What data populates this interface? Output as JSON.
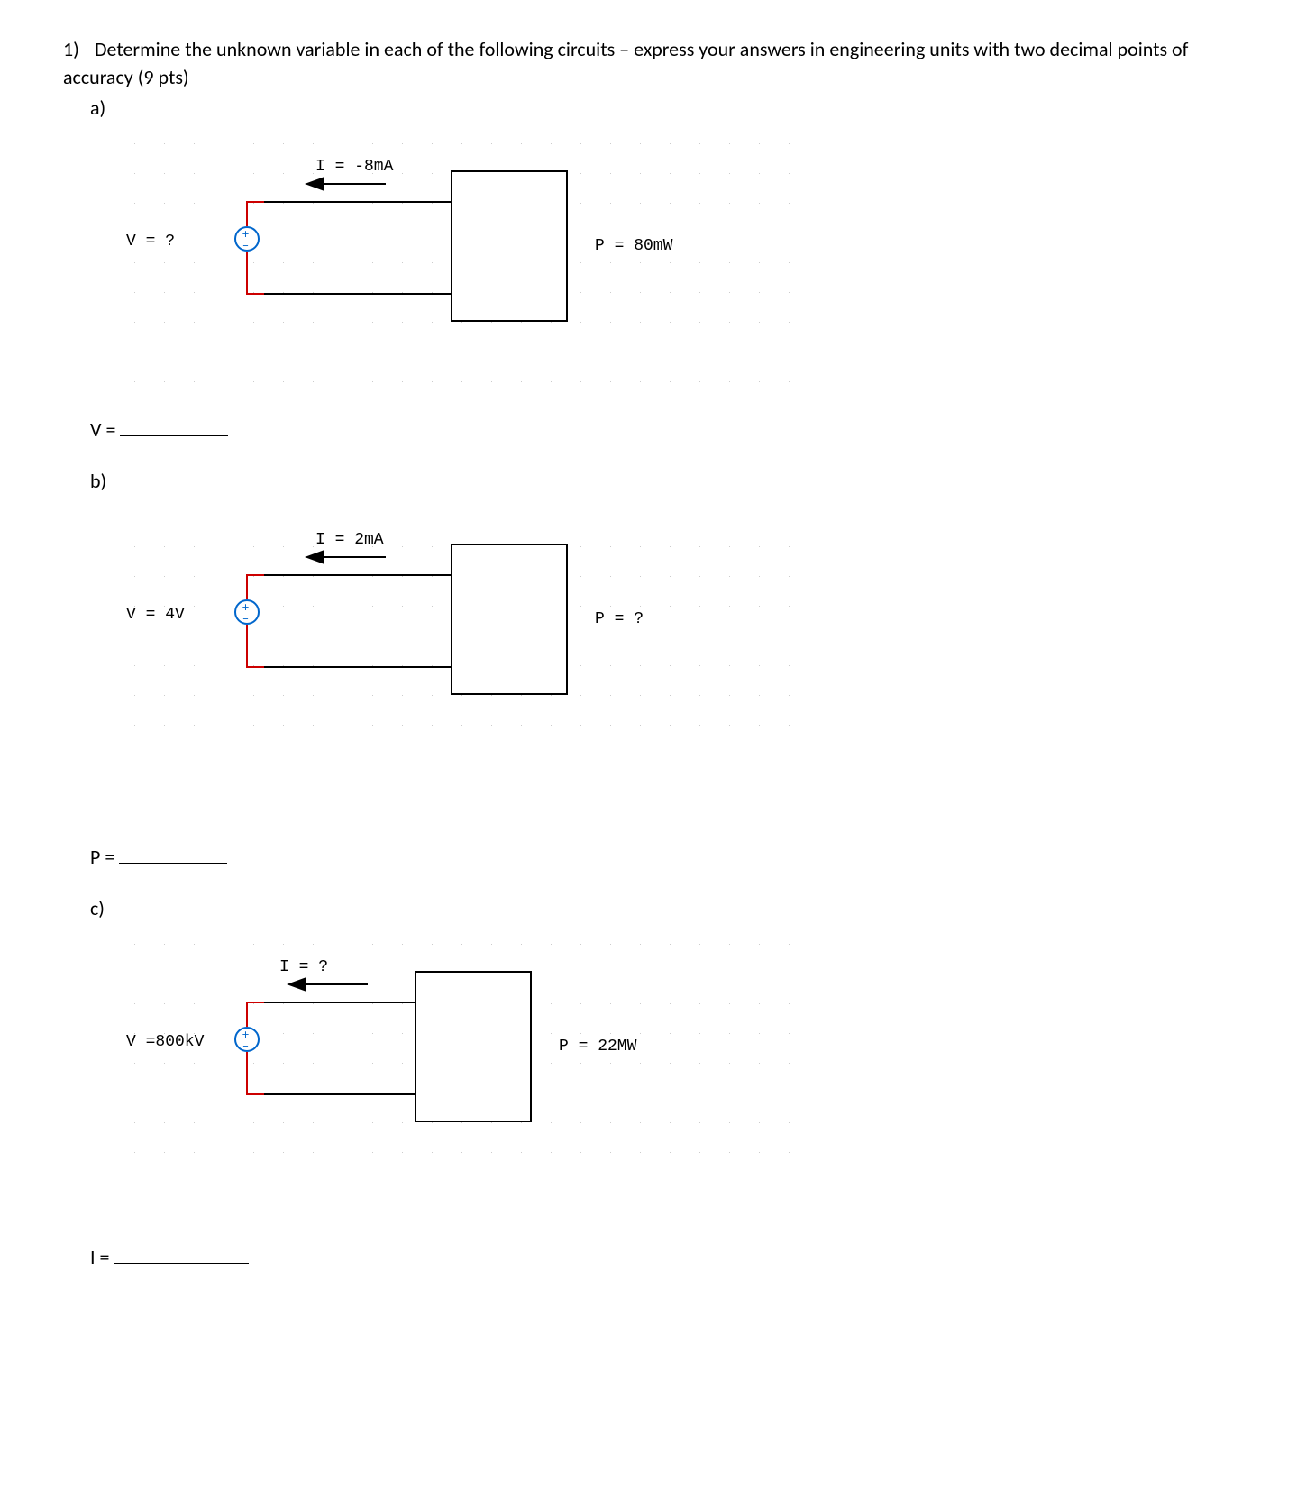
{
  "question": {
    "number": "1)",
    "text": "Determine the unknown variable in each of the following circuits – express your answers in engineering units with two decimal points of accuracy (9 pts)"
  },
  "parts": {
    "a": {
      "label": "a)",
      "V_label": "V = ?",
      "I_label": "I = -8mA",
      "P_label": "P = 80mW",
      "answer_prefix": "V ="
    },
    "b": {
      "label": "b)",
      "V_label": "V = 4V",
      "I_label": "I = 2mA",
      "P_label": "P = ?",
      "answer_prefix": "P ="
    },
    "c": {
      "label": "c)",
      "V_label": "V =800kV",
      "I_label": "I = ?",
      "P_label": "P = 22MW",
      "answer_prefix": "I ="
    }
  }
}
